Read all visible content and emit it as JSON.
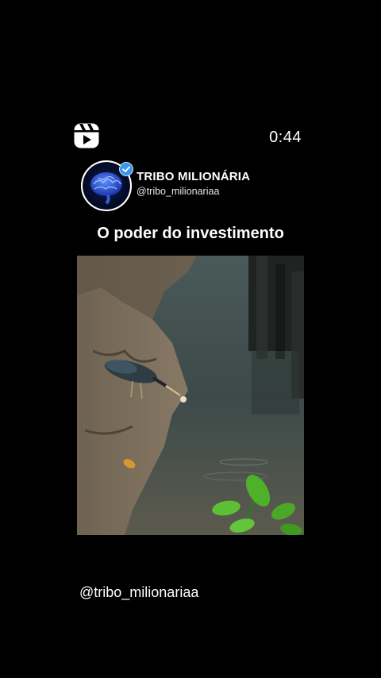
{
  "timer": "0:44",
  "profile": {
    "name": "TRIBO MILIONÁRIA",
    "handle": "@tribo_milionariaa"
  },
  "headline": "O poder do investimento",
  "caption": {
    "handle": "@tribo_milionariaa"
  },
  "icons": {
    "reels": "reels-icon",
    "verified": "verified-badge-icon",
    "avatar": "brain-avatar"
  },
  "colors": {
    "background": "#000000",
    "text": "#ffffff",
    "verified": "#3797f0",
    "brain": "#2a4cc9"
  }
}
